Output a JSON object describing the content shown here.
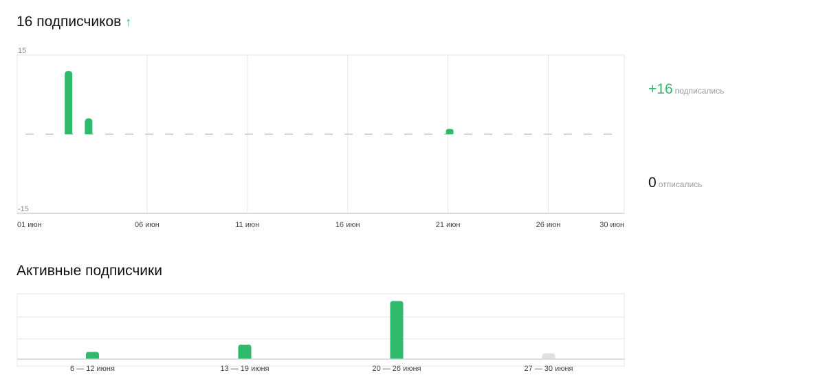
{
  "subscribers": {
    "title": "16 подписчиков",
    "trend_icon": "arrow-up-icon",
    "trend_glyph": "↑",
    "trend_color": "#2fb96a"
  },
  "summary": {
    "subscribed_value": "+16",
    "subscribed_label": "подписались",
    "unsubscribed_value": "0",
    "unsubscribed_label": "отписались"
  },
  "active": {
    "title": "Активные подписчики"
  },
  "colors": {
    "bar": "#2fb96a",
    "bar_muted": "#e0e0e0",
    "grid": "#e6e6e6",
    "zero_line": "#d3d7d8"
  },
  "chart_data": [
    {
      "type": "bar",
      "ylim": [
        -15,
        15
      ],
      "y_ticks": [
        "15",
        "-15"
      ],
      "x_tick_labels": [
        "01 июн",
        "06 июн",
        "11 июн",
        "16 июн",
        "21 июн",
        "26 июн",
        "30 июн"
      ],
      "categories": [
        "01 июн",
        "02 июн",
        "03 июн",
        "04 июн",
        "05 июн",
        "06 июн",
        "07 июн",
        "08 июн",
        "09 июн",
        "10 июн",
        "11 июн",
        "12 июн",
        "13 июн",
        "14 июн",
        "15 июн",
        "16 июн",
        "17 июн",
        "18 июн",
        "19 июн",
        "20 июн",
        "21 июн",
        "22 июн",
        "23 июн",
        "24 июн",
        "25 июн",
        "26 июн",
        "27 июн",
        "28 июн",
        "29 июн",
        "30 июн"
      ],
      "values": [
        0,
        12,
        3,
        0,
        0,
        0,
        0,
        0,
        0,
        0,
        0,
        0,
        0,
        0,
        0,
        0,
        0,
        0,
        0,
        0,
        1,
        0,
        0,
        0,
        0,
        0,
        0,
        0,
        0,
        0
      ],
      "grid": true
    },
    {
      "type": "bar",
      "categories": [
        "6 — 12 июня",
        "13 — 19 июня",
        "20 — 26 июня",
        "27 — 30 июня"
      ],
      "values": [
        1,
        2,
        8,
        1
      ],
      "ylim": [
        0,
        9
      ],
      "grid": true
    }
  ]
}
